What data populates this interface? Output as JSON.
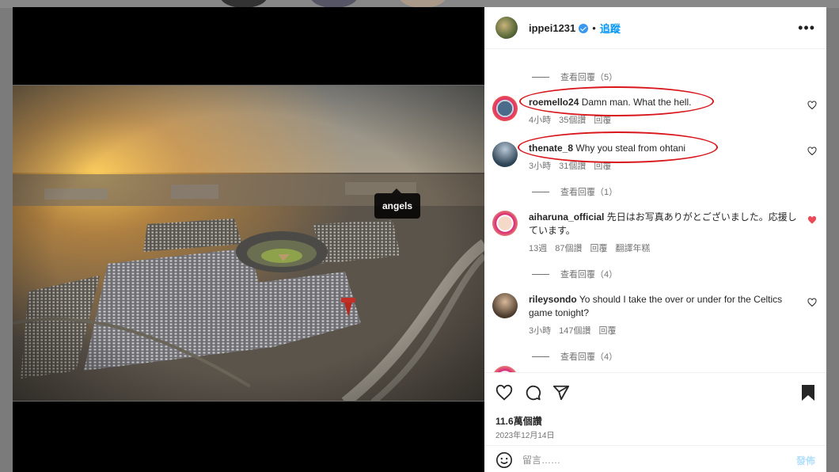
{
  "post": {
    "username": "ippei1231",
    "follow_label": "追蹤",
    "photo_tag": "angels",
    "likes": "11.6萬個讚",
    "date": "2023年12月14日"
  },
  "comments": [
    {
      "user": "roemello24",
      "text": "Damn man. What the hell.",
      "time": "4小時",
      "likes": "35個讚",
      "reply": "回覆",
      "translate": "",
      "highlighted": true
    },
    {
      "user": "thenate_8",
      "text": "Why you steal from ohtani",
      "time": "3小時",
      "likes": "31個讚",
      "reply": "回覆",
      "translate": "",
      "highlighted": true
    },
    {
      "user": "aiharuna_official",
      "text": "先日はお写真ありがとございました。応援しています。",
      "time": "13週",
      "likes": "87個讚",
      "reply": "回覆",
      "translate": "翻譯年糕",
      "highlighted": false
    },
    {
      "user": "rileysondo",
      "text": "Yo should I take the over or under for the Celtics game tonight?",
      "time": "3小時",
      "likes": "147個讚",
      "reply": "回覆",
      "translate": "",
      "highlighted": false
    }
  ],
  "view_replies": [
    "查看回覆（5）",
    "查看回覆（1）",
    "查看回覆（4）",
    "查看回覆（4）"
  ],
  "composer": {
    "placeholder": "留言……",
    "post_label": "發佈"
  },
  "colors": {
    "highlight_ring": "#d8161b",
    "link_blue": "#0095f6",
    "liked_heart": "#ed4956"
  }
}
